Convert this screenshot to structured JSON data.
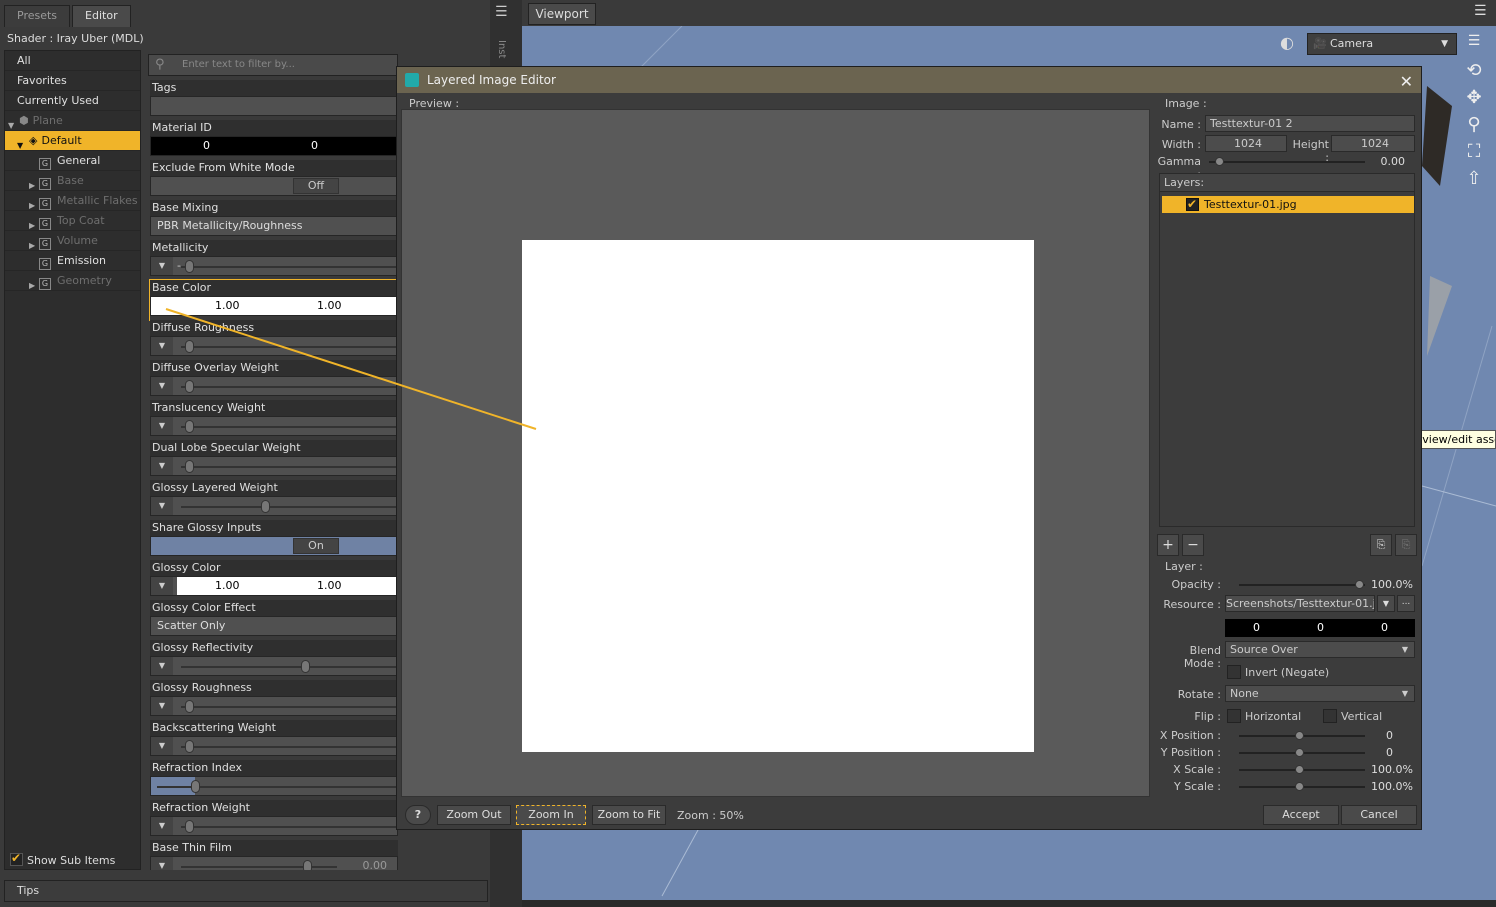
{
  "left_panel": {
    "tabs": [
      "Presets",
      "Editor"
    ],
    "shader_line": "Shader :  Iray Uber (MDL)",
    "filter_items": [
      {
        "label": "All"
      },
      {
        "label": "Favorites"
      },
      {
        "label": "Currently Used"
      },
      {
        "label": "Plane"
      },
      {
        "label": "Default"
      },
      {
        "label": "General"
      },
      {
        "label": "Base"
      },
      {
        "label": "Metallic Flakes"
      },
      {
        "label": "Top Coat"
      },
      {
        "label": "Volume"
      },
      {
        "label": "Emission"
      },
      {
        "label": "Geometry"
      }
    ],
    "search_placeholder": "Enter text to filter by...",
    "show_sub_items": "Show Sub Items",
    "tips": "Tips",
    "properties": {
      "tags": "Tags",
      "material_id": "Material ID",
      "material_id_v1": "0",
      "material_id_v2": "0",
      "exclude": "Exclude From White Mode",
      "exclude_val": "Off",
      "base_mixing": "Base Mixing",
      "base_mixing_val": "PBR Metallicity/Roughness",
      "metallicity": "Metallicity",
      "base_color": "Base Color",
      "base_color_v1": "1.00",
      "base_color_v2": "1.00",
      "diffuse_roughness": "Diffuse Roughness",
      "diffuse_overlay": "Diffuse Overlay Weight",
      "translucency": "Translucency Weight",
      "dual_lobe": "Dual Lobe Specular Weight",
      "glossy_layered": "Glossy Layered Weight",
      "share_glossy": "Share Glossy Inputs",
      "share_glossy_val": "On",
      "glossy_color": "Glossy Color",
      "glossy_color_v1": "1.00",
      "glossy_color_v2": "1.00",
      "glossy_effect": "Glossy Color Effect",
      "glossy_effect_val": "Scatter Only",
      "glossy_reflectivity": "Glossy Reflectivity",
      "glossy_roughness": "Glossy Roughness",
      "backscattering": "Backscattering Weight",
      "refraction_index": "Refraction Index",
      "refraction_weight": "Refraction Weight",
      "base_thin_film": "Base Thin Film",
      "base_thin_film_val": "0.00"
    }
  },
  "viewport": {
    "tab": "Viewport",
    "camera": "Camera",
    "gutter_text": "Inst",
    "tooltip": "Select a layer to view/edit associa"
  },
  "dialog": {
    "title": "Layered Image Editor",
    "preview_label": "Preview :",
    "image_section": "Image :",
    "name_label": "Name :",
    "name_val": "Testtextur-01 2",
    "width_label": "Width :",
    "width_val": "1024",
    "height_label": "Height :",
    "height_val": "1024",
    "gamma_label": "Gamma :",
    "gamma_val": "0.00",
    "layers_label": "Layers:",
    "layer_item": "Testtextur-01.jpg",
    "layer_section": "Layer :",
    "opacity_label": "Opacity :",
    "opacity_val": "100.0%",
    "resource_label": "Resource :",
    "resource_val": "Screenshots/Testtextur-01.jpg",
    "rgb": [
      "0",
      "0",
      "0"
    ],
    "blend_label": "Blend Mode :",
    "blend_val": "Source Over",
    "invert_label": "Invert (Negate)",
    "rotate_label": "Rotate :",
    "rotate_val": "None",
    "flip_label": "Flip :",
    "flip_h": "Horizontal",
    "flip_v": "Vertical",
    "xpos_label": "X Position :",
    "xpos_val": "0",
    "ypos_label": "Y Position :",
    "ypos_val": "0",
    "xscale_label": "X Scale :",
    "xscale_val": "100.0%",
    "yscale_label": "Y Scale :",
    "yscale_val": "100.0%",
    "zoom_out": "Zoom Out",
    "zoom_in": "Zoom In",
    "zoom_fit": "Zoom to Fit",
    "zoom_readout": "Zoom : 50%",
    "accept": "Accept",
    "cancel": "Cancel"
  },
  "colors": {
    "accent": "#f0b429",
    "viewport_bg": "#7088b0",
    "dialog_title": "#6b6450"
  }
}
